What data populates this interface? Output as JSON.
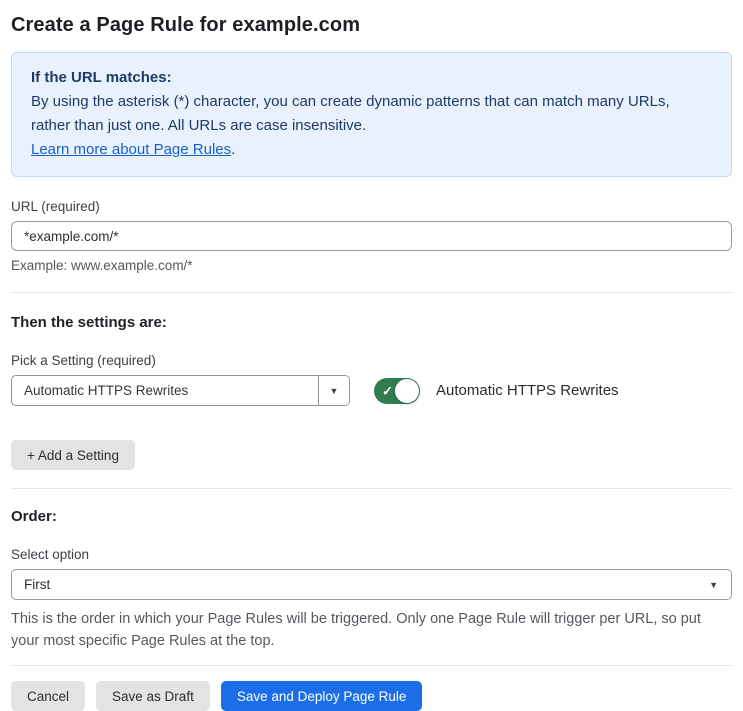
{
  "page": {
    "title": "Create a Page Rule for example.com"
  },
  "info_box": {
    "heading": "If the URL matches:",
    "body": "By using the asterisk (*) character, you can create dynamic patterns that can match many URLs, rather than just one. All URLs are case insensitive.",
    "link_label": "Learn more about Page Rules",
    "link_suffix": "."
  },
  "url_field": {
    "label": "URL (required)",
    "value": "*example.com/*",
    "helper": "Example: www.example.com/*"
  },
  "settings": {
    "heading": "Then the settings are:",
    "picker_label": "Pick a Setting (required)",
    "picker_value": "Automatic HTTPS Rewrites",
    "toggle_label": "Automatic HTTPS Rewrites",
    "toggle_state": "on",
    "add_button_label": "+ Add a Setting"
  },
  "order": {
    "heading": "Order:",
    "select_label": "Select option",
    "select_value": "First",
    "helper": "This is the order in which your Page Rules will be triggered. Only one Page Rule will trigger per URL, so put your most specific Page Rules at the top."
  },
  "footer": {
    "cancel_label": "Cancel",
    "save_draft_label": "Save as Draft",
    "deploy_label": "Save and Deploy Page Rule"
  },
  "icons": {
    "caret_down": "▼",
    "check": "✓"
  },
  "colors": {
    "info_bg": "#e9f2fc",
    "info_border": "#bfdbf7",
    "info_text": "#1e3a66",
    "link_blue": "#1a5fc8",
    "toggle_green": "#2f7d4e",
    "primary_blue": "#1b6ee8",
    "gray_button": "#e3e3e4"
  }
}
